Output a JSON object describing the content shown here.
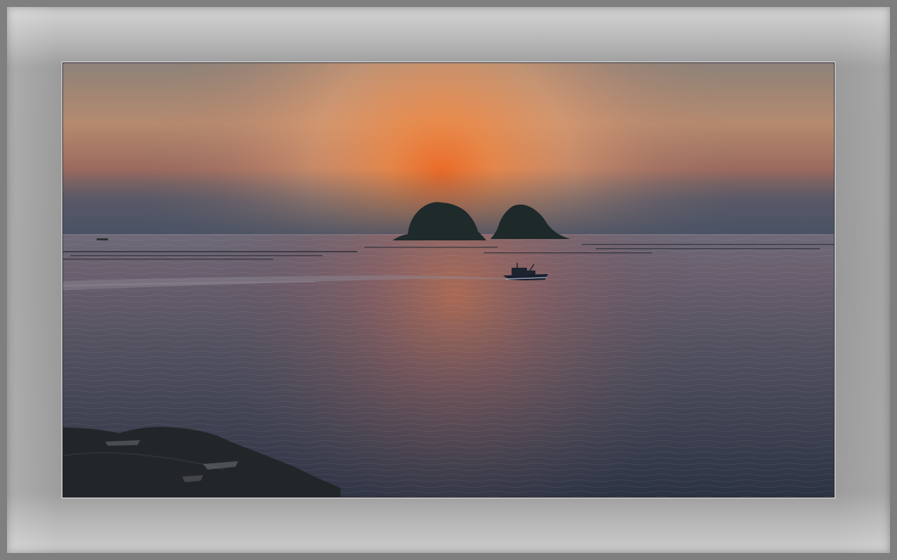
{
  "frame": {
    "outer_color": "#7f7f7f",
    "mat_color": "#9a9a9a",
    "inner_border_color": "#e9e9e9"
  },
  "photo": {
    "scene": "sunset-over-sea",
    "colors": {
      "sky_top": "#8a7f76",
      "sky_glow": "#f0a060",
      "sun_core": "#e86a2a",
      "haze": "#4e5666",
      "sea_light": "#7a6f78",
      "sea_dark": "#2d3444",
      "silhouette": "#1f2a2a"
    }
  }
}
